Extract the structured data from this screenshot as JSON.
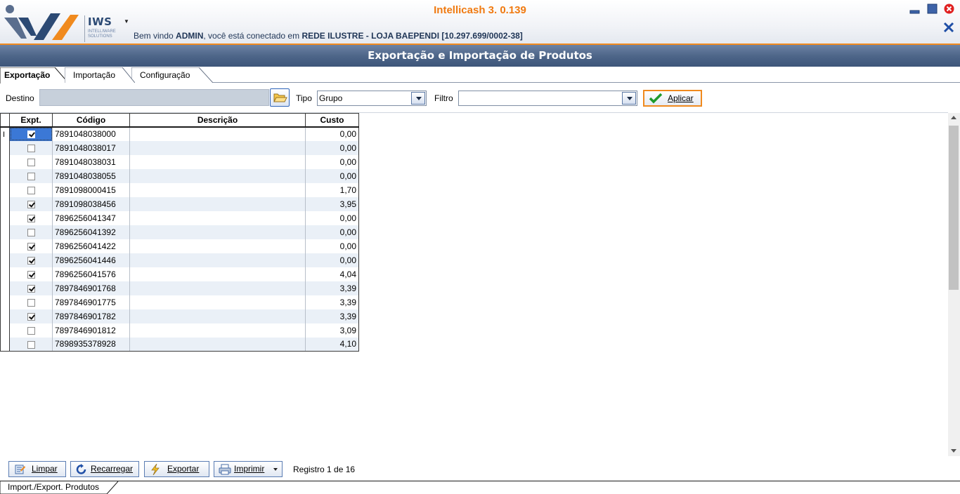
{
  "header": {
    "app_title": "Intellicash 3. 0.139",
    "logo_brand": "IWS",
    "logo_sub1": "INTELLIWARE",
    "logo_sub2": "SOLUTIONS",
    "welcome_prefix": "Bem vindo ",
    "welcome_user": "ADMIN",
    "welcome_middle": ", você está conectado em ",
    "welcome_store": "REDE ILUSTRE - LOJA BAEPENDI [10.297.699/0002-38]",
    "colors": {
      "accent": "#f08a1e",
      "title_bar": "#4e6689",
      "text_dark": "#1f3556"
    }
  },
  "title_bar": {
    "title": "Exportação e Importação de Produtos"
  },
  "tabs": [
    {
      "label": "Exportação",
      "active": true
    },
    {
      "label": "Importação",
      "active": false
    },
    {
      "label": "Configuração",
      "active": false
    }
  ],
  "toolbar": {
    "destino_label": "Destino",
    "destino_value": "",
    "tipo_label": "Tipo",
    "tipo_value": "Grupo",
    "filtro_label": "Filtro",
    "filtro_value": "",
    "aplicar_label": "Aplicar"
  },
  "grid": {
    "columns": [
      "Expt.",
      "Código",
      "Descrição",
      "Custo"
    ],
    "rows": [
      {
        "expt": true,
        "codigo": "7891048038000",
        "descricao": "",
        "custo": "0,00"
      },
      {
        "expt": false,
        "codigo": "7891048038017",
        "descricao": "",
        "custo": "0,00"
      },
      {
        "expt": false,
        "codigo": "7891048038031",
        "descricao": "",
        "custo": "0,00"
      },
      {
        "expt": false,
        "codigo": "7891048038055",
        "descricao": "",
        "custo": "0,00"
      },
      {
        "expt": false,
        "codigo": "7891098000415",
        "descricao": "",
        "custo": "1,70"
      },
      {
        "expt": true,
        "codigo": "7891098038456",
        "descricao": "",
        "custo": "3,95"
      },
      {
        "expt": true,
        "codigo": "7896256041347",
        "descricao": "",
        "custo": "0,00"
      },
      {
        "expt": false,
        "codigo": "7896256041392",
        "descricao": "",
        "custo": "0,00"
      },
      {
        "expt": true,
        "codigo": "7896256041422",
        "descricao": "",
        "custo": "0,00"
      },
      {
        "expt": true,
        "codigo": "7896256041446",
        "descricao": "",
        "custo": "0,00"
      },
      {
        "expt": true,
        "codigo": "7896256041576",
        "descricao": "",
        "custo": "4,04"
      },
      {
        "expt": true,
        "codigo": "7897846901768",
        "descricao": "",
        "custo": "3,39"
      },
      {
        "expt": false,
        "codigo": "7897846901775",
        "descricao": "",
        "custo": "3,39"
      },
      {
        "expt": true,
        "codigo": "7897846901782",
        "descricao": "",
        "custo": "3,39"
      },
      {
        "expt": false,
        "codigo": "7897846901812",
        "descricao": "",
        "custo": "3,09"
      },
      {
        "expt": false,
        "codigo": "7898935378928",
        "descricao": "",
        "custo": "4,10"
      }
    ]
  },
  "bottom": {
    "limpar_label": "Limpar",
    "recarregar_label": "Recarregar",
    "exportar_label": "Exportar",
    "imprimir_label": "Imprimir",
    "registro_text": "Registro 1 de 16"
  },
  "status": {
    "tab_label": "Import./Export. Produtos"
  },
  "icons": {
    "window_minimize": "minimize-icon",
    "window_maximize": "maximize-icon",
    "window_close": "close-icon",
    "destino_browse": "folder-open-icon",
    "aplicar": "checkmark-icon",
    "limpar": "eraser-icon",
    "recarregar": "refresh-icon",
    "exportar": "lightning-icon",
    "imprimir": "printer-icon"
  }
}
